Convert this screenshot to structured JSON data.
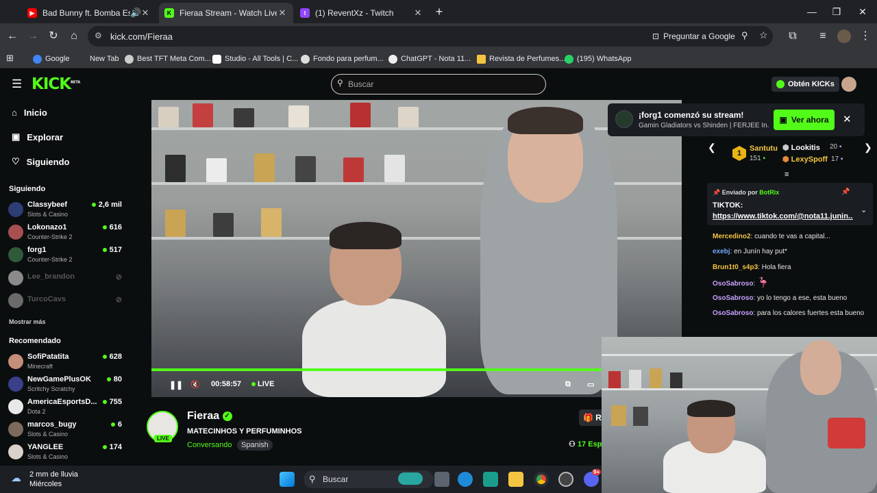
{
  "tabs": [
    {
      "title": "Bad Bunny ft. Bomba Estéreo",
      "favicon": "youtube-icon",
      "color": "#ff0000"
    },
    {
      "title": "Fieraa Stream - Watch Live on Kick",
      "favicon": "kick-icon",
      "color": "#53fc18",
      "active": true
    },
    {
      "title": "(1) ReventXz - Twitch",
      "favicon": "twitch-icon",
      "color": "#9146ff"
    }
  ],
  "toolbar": {
    "url": "kick.com/Fieraa",
    "ask_google": "Preguntar a Google"
  },
  "bookmarks": [
    "Google",
    "New Tab",
    "Best TFT Meta Com...",
    "Studio - All Tools | C...",
    "Fondo para perfum...",
    "ChatGPT - Nota 11...",
    "Revista de Perfumes...",
    "(195) WhatsApp"
  ],
  "kick": {
    "logo": "KICK",
    "logo_badge": "BETA",
    "search_placeholder": "Buscar",
    "get_kicks": "Obtén KICKs",
    "brand_color": "#53fc18"
  },
  "sidebar": {
    "nav": [
      {
        "label": "Inicio",
        "icon": "home-icon"
      },
      {
        "label": "Explorar",
        "icon": "explore-icon"
      },
      {
        "label": "Siguiendo",
        "icon": "heart-icon"
      }
    ],
    "following_title": "Siguiendo",
    "following": [
      {
        "name": "Classybeef",
        "category": "Slots & Casino",
        "viewers": "2,6 mil",
        "live": true
      },
      {
        "name": "Lokonazo1",
        "category": "Counter-Strike 2",
        "viewers": "616",
        "live": true
      },
      {
        "name": "forg1",
        "category": "Counter-Strike 2",
        "viewers": "517",
        "live": true
      },
      {
        "name": "Lee_brandon",
        "live": false
      },
      {
        "name": "TurcoCavs",
        "live": false
      }
    ],
    "show_more": "Mostrar más",
    "recommended_title": "Recomendado",
    "recommended": [
      {
        "name": "SofiPatatita",
        "category": "Minecraft",
        "viewers": "628"
      },
      {
        "name": "NewGamePlusOK",
        "category": "Scritchy Scratchy",
        "viewers": "80"
      },
      {
        "name": "AmericaEsportsD...",
        "category": "Dota 2",
        "viewers": "755"
      },
      {
        "name": "marcos_bugy",
        "category": "Slots & Casino",
        "viewers": "6"
      },
      {
        "name": "YANGLEE",
        "category": "Slots & Casino",
        "viewers": "174"
      }
    ]
  },
  "player": {
    "elapsed": "00:58:57",
    "live_label": "LIVE"
  },
  "notification": {
    "title": "¡forg1 comenzó su stream!",
    "subtitle": "Gamin Gladiators vs Shinden | FERJEE In...",
    "button": "Ver ahora"
  },
  "leaderboard": {
    "first": {
      "rank": "1",
      "name": "Santutu",
      "count": "151"
    },
    "others": [
      {
        "name": "Lookitis",
        "count": "20"
      },
      {
        "name": "LexySpoff",
        "count": "17"
      }
    ]
  },
  "chat": {
    "pinned": {
      "sent_by": "Enviado por",
      "bot": "BotRix",
      "line1": "TIKTOK:",
      "line2": "https://www.tiktok.com/@nota11.junin..."
    },
    "messages": [
      {
        "user": "Mercedino2",
        "color": "#f5c542",
        "text": "cuando te vas a capital..."
      },
      {
        "user": "exebj",
        "color": "#6ea8ff",
        "text": "en Junín hay put*"
      },
      {
        "user": "Brun1t0_s4p3",
        "color": "#f5c542",
        "text": "Hola fiera"
      },
      {
        "user": "OsoSabroso",
        "color": "#c9a0ff",
        "text": ""
      },
      {
        "user": "OsoSabroso",
        "color": "#c9a0ff",
        "text": "yo lo tengo a ese, esta bueno"
      },
      {
        "user": "OsoSabroso",
        "color": "#c9a0ff",
        "text": "para los calores fuertes esta bueno"
      }
    ]
  },
  "channel": {
    "name": "Fieraa",
    "live_badge": "LIVE",
    "title": "MATECINHOS Y PERFUMINHOS",
    "category": "Conversando",
    "language": "Spanish",
    "viewers": "17 Esp",
    "button_partial": "R"
  },
  "taskbar": {
    "weather": "2 mm de lluvia",
    "day": "Miércoles",
    "search": "Buscar",
    "badge": "9+"
  }
}
